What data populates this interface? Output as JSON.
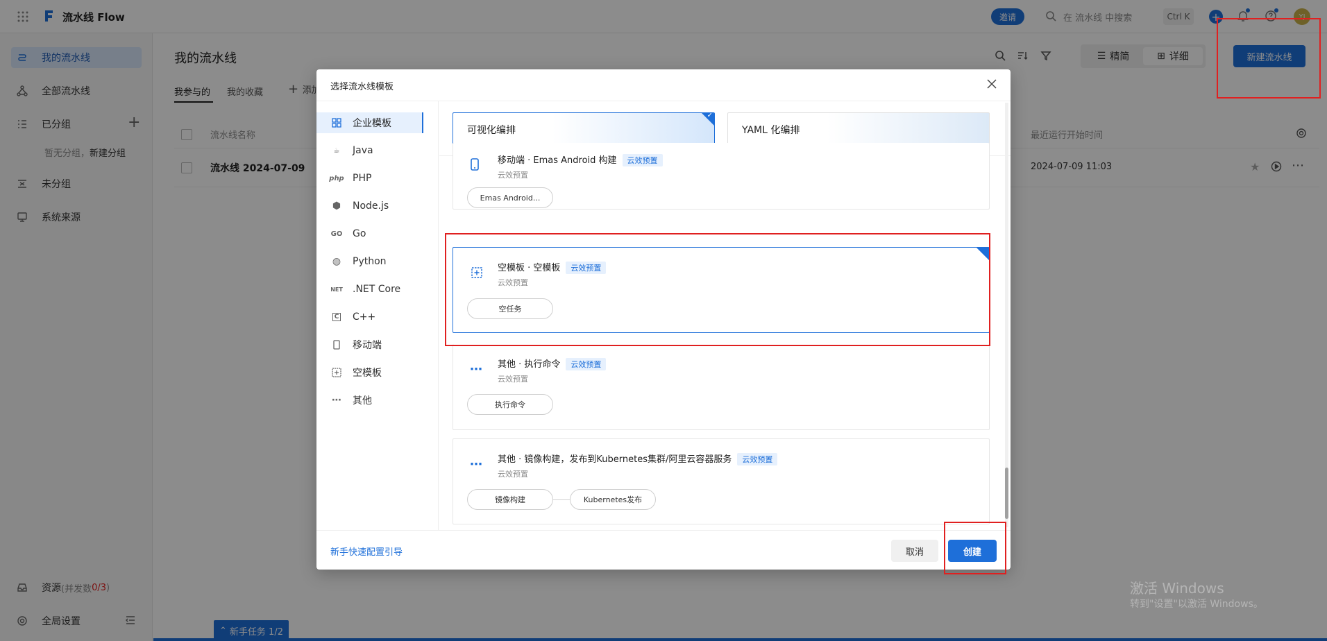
{
  "app": {
    "name": "流水线 Flow"
  },
  "topbar": {
    "invite": "邀请",
    "search_placeholder": "在 流水线 中搜索",
    "shortcut": "Ctrl K",
    "avatar": "YJ"
  },
  "sidebar": {
    "items": [
      {
        "label": "我的流水线"
      },
      {
        "label": "全部流水线"
      },
      {
        "label": "已分组"
      },
      {
        "label": "未分组"
      },
      {
        "label": "系统来源"
      }
    ],
    "group_hint_prefix": "暂无分组，",
    "group_hint_link": "新建分组",
    "resource_label": "资源",
    "resource_suffix": " (并发数",
    "resource_count": "0/3",
    "resource_close": ")",
    "settings": "全局设置"
  },
  "main": {
    "title": "我的流水线",
    "tabs": [
      "我参与的",
      "我的收藏"
    ],
    "add_tab": "添加",
    "view_simple": "精简",
    "view_detail": "详细",
    "new_button": "新建流水线",
    "table": {
      "col_name": "流水线名称",
      "col_last_run": "最近运行开始时间",
      "rows": [
        {
          "name": "流水线 2024-07-09",
          "last_run": "2024-07-09 11:03"
        }
      ]
    },
    "onboarding": "新手任务 1/2"
  },
  "modal": {
    "title": "选择流水线模板",
    "categories": [
      "企业模板",
      "Java",
      "PHP",
      "Node.js",
      "Go",
      "Python",
      ".NET Core",
      "C++",
      "移动端",
      "空模板",
      "其他"
    ],
    "category_icons": [
      "grid-icon",
      "java-icon",
      "php-icon",
      "node-icon",
      "go-icon",
      "python-icon",
      "dotnet-icon",
      "cpp-icon",
      "mobile-icon",
      "blank-template-icon",
      "more-icon"
    ],
    "modes": [
      "可视化编排",
      "YAML 化编排"
    ],
    "templates": [
      {
        "title": "移动端 · Emas Android 构建",
        "badge": "云效预置",
        "sub": "云效预置",
        "steps": [
          "Emas Android..."
        ]
      },
      {
        "title": "空模板 · 空模板",
        "badge": "云效预置",
        "sub": "云效预置",
        "steps": [
          "空任务"
        ]
      },
      {
        "title": "其他 · 执行命令",
        "badge": "云效预置",
        "sub": "云效预置",
        "steps": [
          "执行命令"
        ]
      },
      {
        "title": "其他 · 镜像构建，发布到Kubernetes集群/阿里云容器服务",
        "badge": "云效预置",
        "sub": "云效预置",
        "steps": [
          "镜像构建",
          "Kubernetes发布"
        ]
      }
    ],
    "guide_link": "新手快速配置引导",
    "cancel": "取消",
    "create": "创建"
  },
  "watermark": {
    "line1": "激活 Windows",
    "line2": "转到\"设置\"以激活 Windows。"
  },
  "colors": {
    "primary": "#1e6fd9",
    "highlight": "#e02020"
  }
}
